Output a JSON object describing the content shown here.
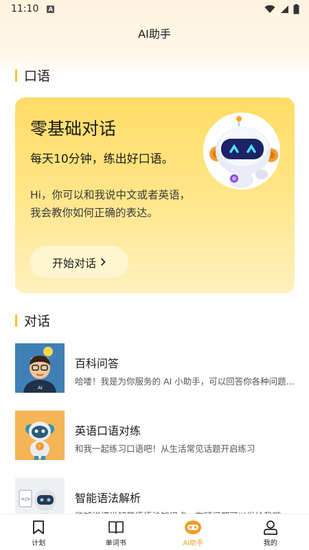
{
  "status_bar": {
    "time": "11:10",
    "notification_icon": "A"
  },
  "header": {
    "title": "AI助手"
  },
  "section_speaking": {
    "title": "口语"
  },
  "promo": {
    "title": "零基础对话",
    "subtitle": "每天10分钟，练出好口语。",
    "description": "Hi，你可以和我说中文或者英语，我会教你如何正确的表达。",
    "button_label": "开始对话"
  },
  "section_chat": {
    "title": "对话"
  },
  "chat_items": [
    {
      "title": "百科问答",
      "description": "哈喽！我是为你服务的 AI 小助手，可以回答你各种问题..."
    },
    {
      "title": "英语口语对练",
      "description": "和我一起练习口语吧！从生活常见话题开启练习"
    },
    {
      "title": "智能语法解析",
      "description": "能够详细讲解英语语法知识点，有疑问都可以发给我哦"
    }
  ],
  "bottom_nav": [
    {
      "label": "计划",
      "icon": "bookmark-icon"
    },
    {
      "label": "单词书",
      "icon": "book-icon"
    },
    {
      "label": "AI助手",
      "icon": "robot-icon",
      "active": true
    },
    {
      "label": "我的",
      "icon": "user-icon"
    }
  ],
  "colors": {
    "accent": "#f59a23",
    "section_bar": "#f5c431",
    "promo_bg": "#ffdc66"
  }
}
